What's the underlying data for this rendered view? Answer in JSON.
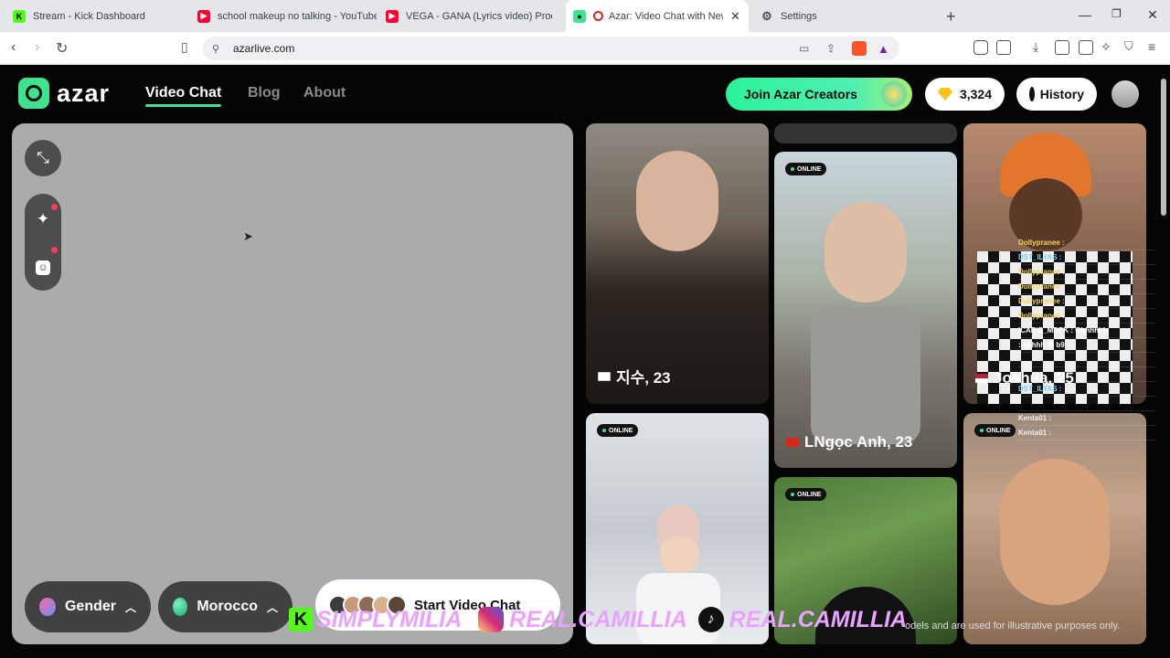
{
  "browser": {
    "tabs": [
      {
        "title": "Stream - Kick Dashboard",
        "icon": "kick-icon",
        "color": "#53fc18"
      },
      {
        "title": "school makeup no talking - YouTube",
        "icon": "youtube-icon",
        "color": "#ff0033"
      },
      {
        "title": "VEGA - GANA (Lyrics video) Prod By",
        "icon": "youtube-icon",
        "color": "#ff0033"
      },
      {
        "title": "Azar: Video Chat with New Pe",
        "icon": "azar-icon",
        "color": "#3ee38f",
        "active": true
      },
      {
        "title": "Settings",
        "icon": "gear-icon",
        "color": "#555555"
      }
    ],
    "url": "azarlive.com"
  },
  "site": {
    "logo": "azar",
    "nav": [
      {
        "label": "Video Chat",
        "active": true
      },
      {
        "label": "Blog"
      },
      {
        "label": "About"
      }
    ],
    "creators_button": "Join Azar Creators",
    "gems": "3,324",
    "history": "History"
  },
  "controls": {
    "gender": "Gender",
    "country": "Morocco",
    "start": "Start Video Chat"
  },
  "profiles": [
    {
      "name": "지수, 23",
      "flag": "kr",
      "online": false
    },
    {
      "name": "LNgọc Anh, 23",
      "flag": "vn",
      "online": true,
      "online_label": "ONLINE"
    },
    {
      "name": "Joshua, 25",
      "flag": "us",
      "online": false
    },
    {
      "online": true,
      "online_label": "ONLINE"
    },
    {
      "online": true,
      "online_label": "ONLINE"
    },
    {
      "online": true,
      "online_label": "ONLINE"
    }
  ],
  "stream_chat": [
    "Dollypranee :",
    "DST_ILYAS :",
    "Dollypranee :",
    "Dollypranee :",
    "Dollypranee :",
    "Dollypranee :",
    "ICARIS_MDPK : Ghhhhhh",
    ": hhhhh ffi b9",
    "",
    "",
    "DST_ILYAS :",
    "",
    "Kenta01 :",
    "Kenta01 :"
  ],
  "overlay": {
    "kick_handle": "SIMPLYMILIA",
    "instagram_handle": "REAL.CAMILLIA",
    "tiktok_handle": "REAL.CAMILLIA"
  },
  "disclaimer": "odels and are used for illustrative purposes only."
}
